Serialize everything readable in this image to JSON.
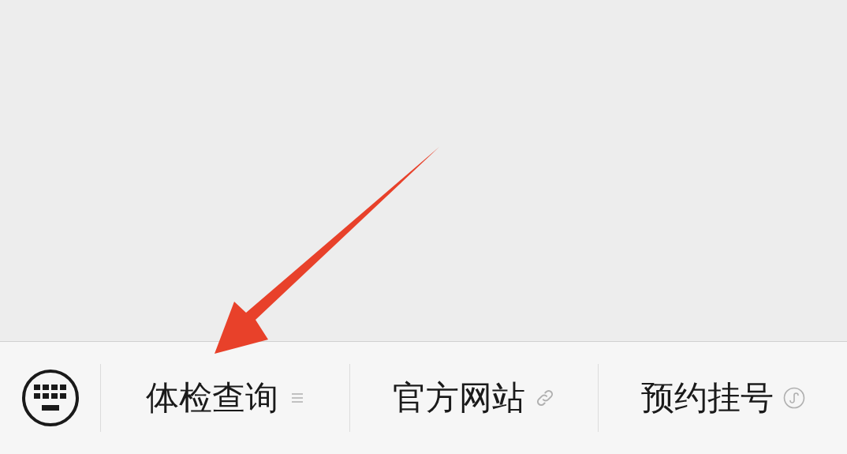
{
  "menu": {
    "items": [
      {
        "label": "体检查询",
        "kind": "submenu"
      },
      {
        "label": "官方网站",
        "kind": "link"
      },
      {
        "label": "预约挂号",
        "kind": "miniprogram"
      }
    ]
  }
}
